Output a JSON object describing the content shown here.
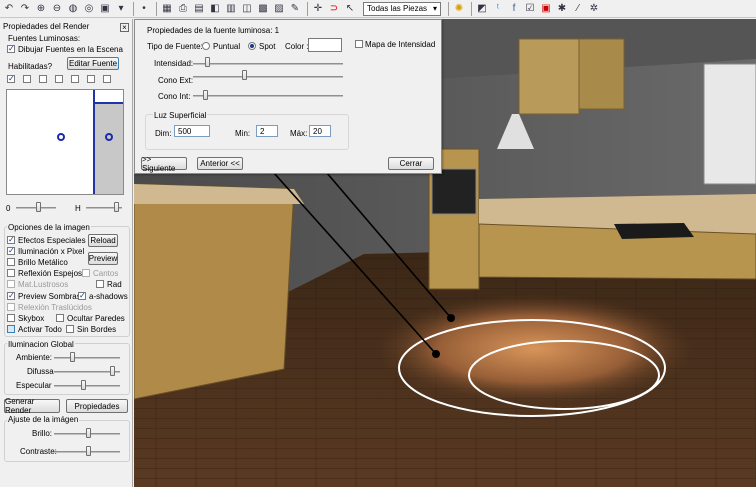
{
  "toolbar": {
    "icons": [
      "undo-icon",
      "redo-icon",
      "zoom-in-icon",
      "zoom-out-icon",
      "globe-icon",
      "target-icon",
      "camera-icon",
      "arrow-down-icon",
      "dot-icon",
      "grid-icon",
      "print-icon",
      "save-icon",
      "layer-icon",
      "layout-icon",
      "wireframe-icon",
      "grid-icon",
      "image-icon",
      "dropper-icon",
      "move-icon",
      "magnet-icon",
      "cursor-icon"
    ],
    "filter_select": "Todas las Piezas",
    "right_icons": [
      "cube-icon",
      "bird-icon",
      "facebook-icon",
      "check-icon",
      "frame-icon",
      "star-icon",
      "wand-icon",
      "settings-icon"
    ]
  },
  "render_panel": {
    "title": "Propiedades del Render",
    "lights_label": "Fuentes Luminosas:",
    "draw_lights_label": "Dibujar Fuentes en la Escena",
    "enabled_label": "Habilitadas?",
    "edit_light_button": "Editar Fuente",
    "slider_left_label": "0",
    "slider_right_label": "H",
    "image_options_title": "Opciones de la imagen",
    "options": {
      "special_effects": "Efectos Especiales",
      "per_pixel": "Iluminación x Pixel",
      "metallic": "Brillo Metálico",
      "mirror": "Reflexión Espejos",
      "edges": "Cantos",
      "mat_lustrous": "Mat.Lustrosos",
      "rad": "Rad",
      "preview_shadows": "Preview Sombras",
      "a_shadows": "a-shadows",
      "translucent": "Relexión Traslúcidos",
      "skybox": "Skybox",
      "hide_walls": "Ocultar Paredes",
      "activate_all": "Activar Todo",
      "no_borders": "Sin Bordes"
    },
    "reload_button": "Reload",
    "preview_button": "Preview",
    "global_title": "Iluminacion Global",
    "ambient": "Ambiente:",
    "diffuse": "Difussa",
    "specular": "Especular",
    "generate_button": "Generar Render",
    "properties_button": "Propiedades",
    "adjust_title": "Ajuste de la imágen",
    "brightness": "Brillo:",
    "contrast": "Contraste:"
  },
  "light_dialog": {
    "title": "Propiedades de la fuente luminosa: 1",
    "type_label": "Tipo de Fuente:",
    "point_label": "Puntual",
    "spot_label": "Spot",
    "color_label": "Color :",
    "intensity_map_label": "Mapa de Intensidad",
    "intensity_label": "Intensidad:",
    "cone_ext_label": "Cono Ext:",
    "cone_int_label": "Cono Int:",
    "surface_title": "Luz Superficial",
    "dim_label": "Dim:",
    "dim_value": "500",
    "min_label": "Min:",
    "min_value": "2",
    "max_label": "Máx:",
    "max_value": "20",
    "next_button": ">> Siguiente",
    "prev_button": "Anterior <<",
    "close_button": "Cerrar"
  }
}
